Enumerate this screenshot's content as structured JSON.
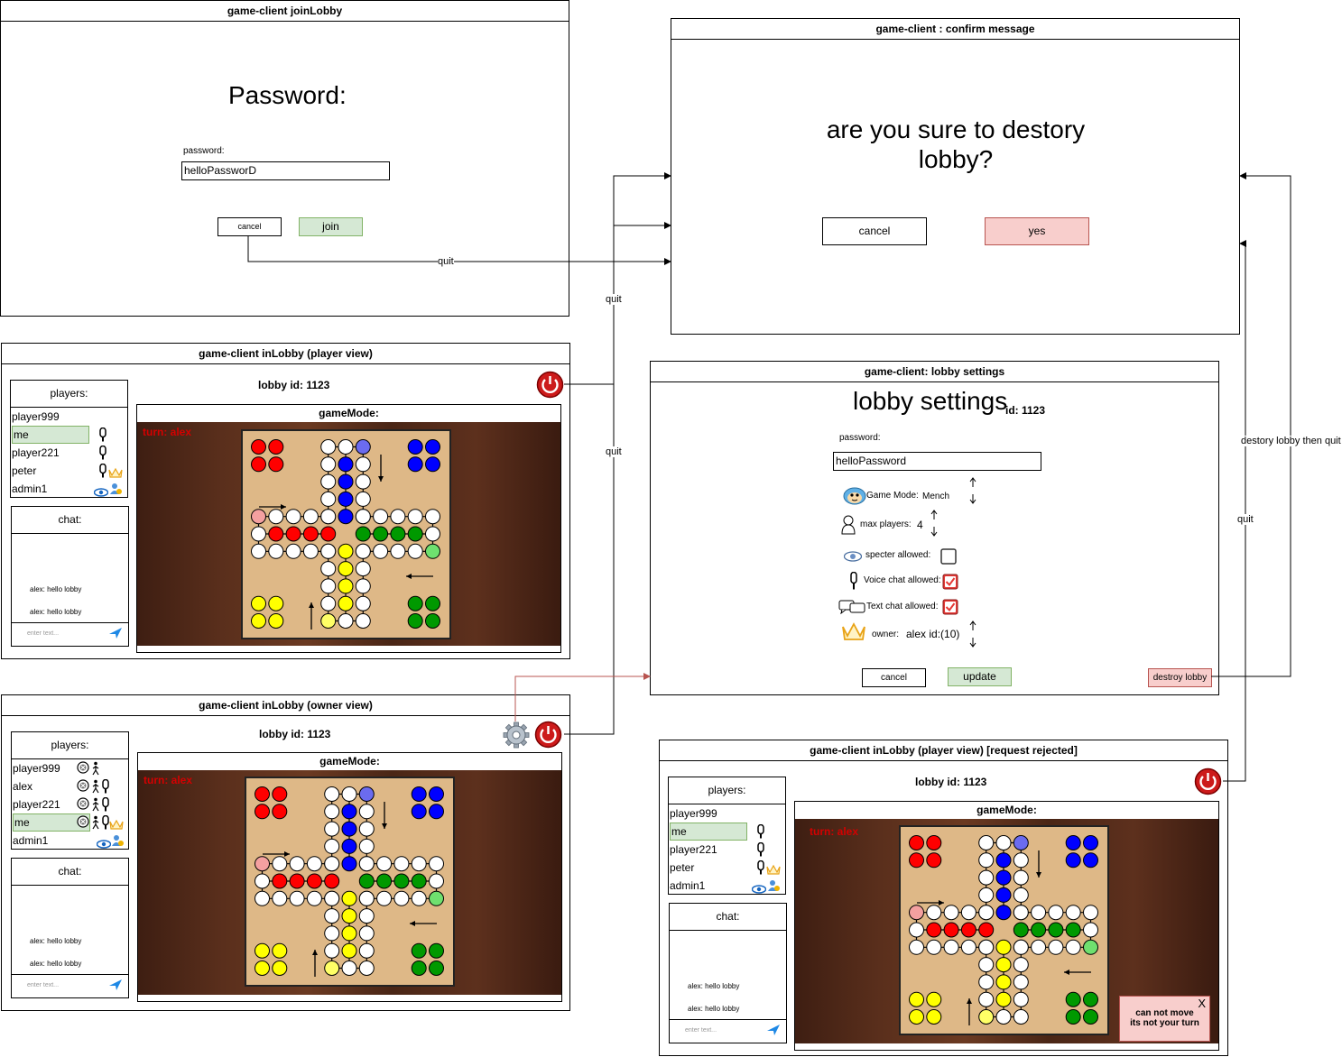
{
  "join_lobby": {
    "title": "game-client joinLobby",
    "heading": "Password:",
    "password_label": "password:",
    "password_value": "helloPassworD",
    "cancel_label": "cancel",
    "join_label": "join"
  },
  "confirm": {
    "title": "game-client : confirm message",
    "question": "are you sure to destory lobby?",
    "cancel_label": "cancel",
    "yes_label": "yes"
  },
  "player_view": {
    "title": "game-client inLobby (player view)",
    "lobby_id": "lobby id: 1123",
    "players_header": "players:",
    "players": [
      "player999",
      "me",
      "player221",
      "peter",
      "admin1"
    ],
    "chat_header": "chat:",
    "messages": [
      "alex: hello lobby",
      "alex: hello lobby"
    ],
    "chat_placeholder": "enter text...",
    "game_header": "gameMode:",
    "turn": "turn: alex"
  },
  "owner_view": {
    "title": "game-client inLobby (owner view)",
    "lobby_id": "lobby id: 1123",
    "players_header": "players:",
    "players": [
      "player999",
      "alex",
      "player221",
      "me",
      "admin1"
    ],
    "chat_header": "chat:",
    "messages": [
      "alex: hello lobby",
      "alex: hello lobby"
    ],
    "chat_placeholder": "enter text...",
    "game_header": "gameMode:",
    "turn": "turn: alex"
  },
  "rejected_view": {
    "title": "game-client inLobby (player view) [request rejected]",
    "lobby_id": "lobby id: 1123",
    "players_header": "players:",
    "players": [
      "player999",
      "me",
      "player221",
      "peter",
      "admin1"
    ],
    "chat_header": "chat:",
    "messages": [
      "alex: hello lobby",
      "alex: hello lobby"
    ],
    "chat_placeholder": "enter text...",
    "game_header": "gameMode:",
    "turn": "turn: alex",
    "toast_close": "X",
    "toast_line1": "can not move",
    "toast_line2": "its not your turn"
  },
  "settings": {
    "title": "game-client: lobby settings",
    "heading": "lobby settings",
    "id_suffix": "id: 1123",
    "password_label": "password:",
    "password_value": "helloPassword",
    "game_mode_label": "Game Mode:",
    "game_mode_value": "Mench",
    "max_players_label": "max players:",
    "max_players_value": "4",
    "spectator_label": "specter allowed:",
    "spectator_checked": false,
    "voice_label": "Voice chat allowed:",
    "voice_checked": true,
    "text_label": "Text chat allowed:",
    "text_checked": true,
    "owner_label": "owner:",
    "owner_value": "alex id:(10)",
    "cancel_label": "cancel",
    "update_label": "update",
    "destroy_label": "destroy lobby"
  },
  "edges": {
    "quit_join": "quit",
    "quit_player": "quit",
    "quit_owner": "quit",
    "quit_rejected": "quit",
    "destroy_then_quit": "destory lobby then quit"
  },
  "colors": {
    "green_fill": "#d5e8d4",
    "red_fill": "#f8cecc",
    "turn_text": "#d40000",
    "board": "#deb887",
    "red_piece": "#ff0000",
    "blue_piece": "#0000ff",
    "green_piece": "#009900",
    "yellow_piece": "#ffff00"
  }
}
